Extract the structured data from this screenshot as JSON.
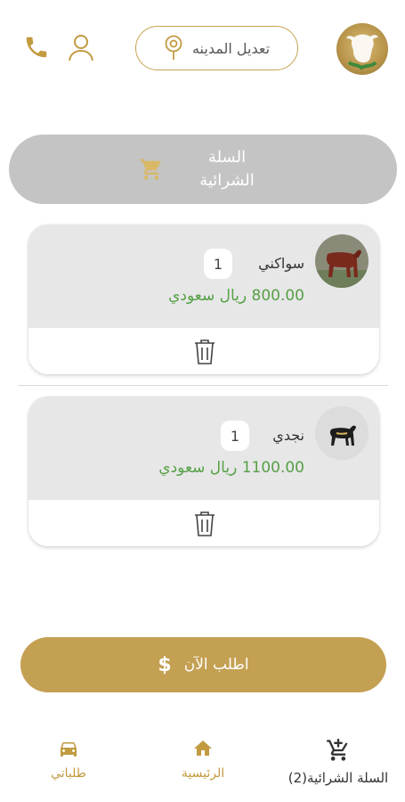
{
  "header": {
    "city_button_label": "تعديل المدينه"
  },
  "cart_header": {
    "title_line1": "السلة",
    "title_line2": "الشرائية"
  },
  "items": [
    {
      "name": "سواكني",
      "quantity": "1",
      "price": "800.00 ريال سعودي"
    },
    {
      "name": "نجدي",
      "quantity": "1",
      "price": "1100.00 ريال سعودي"
    }
  ],
  "order_button": {
    "label": "اطلب الآن",
    "icon": "$"
  },
  "nav": {
    "orders_label": "طلباتي",
    "home_label": "الرئيسية",
    "cart_label": "السلة الشرائية(2)"
  },
  "colors": {
    "gold": "#c4a052",
    "price_green": "#56a045",
    "gray": "#c4c4c4"
  }
}
